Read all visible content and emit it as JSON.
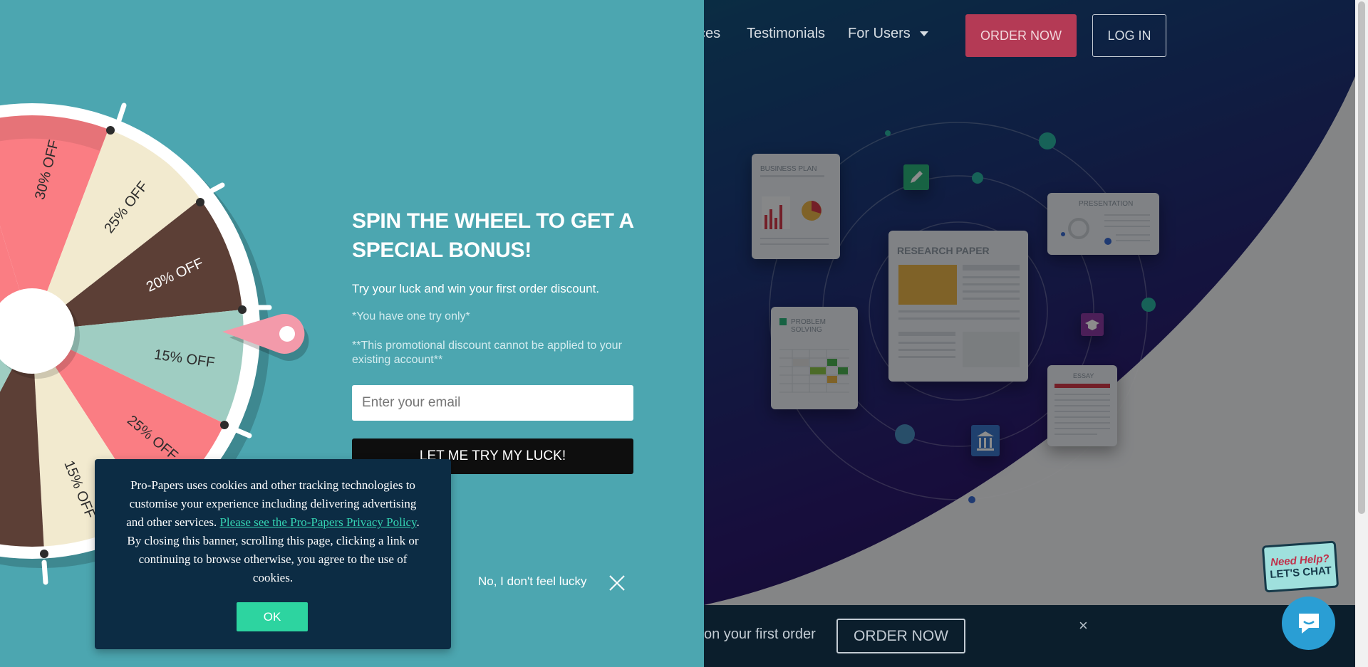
{
  "nav": {
    "services_partial": "ces",
    "testimonials": "Testimonials",
    "for_users": "For Users",
    "order_now": "ORDER NOW",
    "log_in": "LOG IN"
  },
  "hero_cards": {
    "business_plan": "BUSINESS PLAN",
    "presentation": "PRESENTATION",
    "research_paper": "RESEARCH PAPER",
    "problem_solving": "PROBLEM SOLVING",
    "essay": "ESSAY"
  },
  "bottom_bar": {
    "text": "on your first order",
    "order_now": "ORDER NOW",
    "close": "×"
  },
  "chat": {
    "need_help": "Need Help?",
    "lets_chat": "LET'S CHAT"
  },
  "popup": {
    "title": "SPIN THE WHEEL TO GET A SPECIAL BONUS!",
    "subtitle": "Try your luck and win your first order discount.",
    "note1": "*You have one try only*",
    "note2": "**This promotional discount cannot be applied to your existing account**",
    "email_placeholder": "Enter your email",
    "submit_label": "LET ME TRY MY LUCK!",
    "decline_label": "No, I don't feel lucky",
    "wheel_segments": [
      "30% OFF",
      "25% OFF",
      "20% OFF",
      "15% OFF",
      "25% OFF",
      "15% OFF"
    ]
  },
  "cookie": {
    "text_before": "Pro-Papers uses cookies and other tracking technologies to customise your experience including delivering advertising and other services. ",
    "link": "Please see the Pro-Papers Privacy Policy",
    "text_after": ". By closing this banner, scrolling this page, clicking a link or continuing to browse otherwise, you agree to the use of cookies.",
    "ok": "OK"
  },
  "colors": {
    "popup_bg": "#4ca6b0",
    "wheel_pink": "#fa7d83",
    "wheel_cream": "#f2eacf",
    "wheel_brown": "#5c3f36",
    "wheel_mint": "#9fcdc2",
    "cookie_bg": "#0c2c44",
    "cookie_accent": "#2dd4a0"
  }
}
